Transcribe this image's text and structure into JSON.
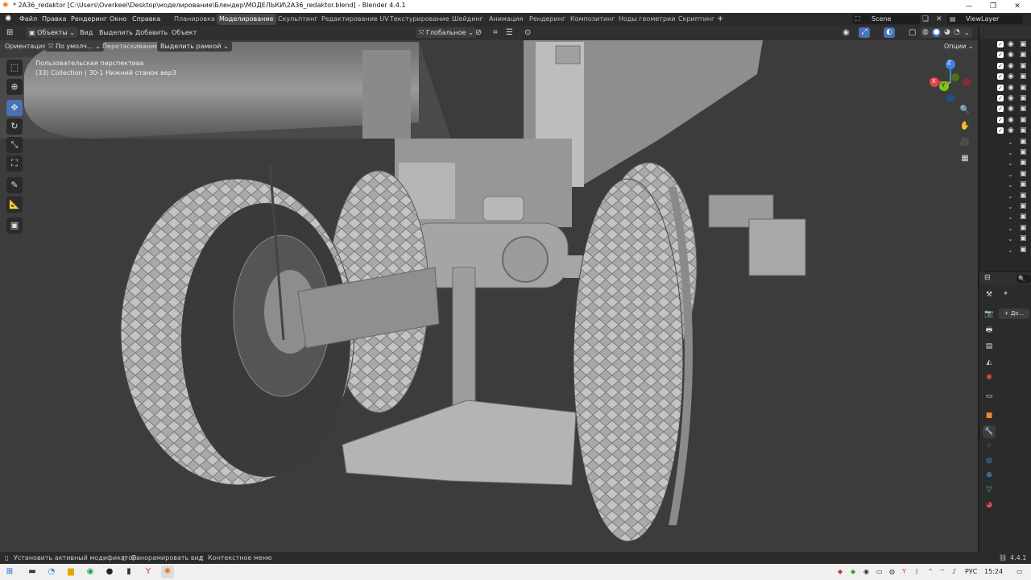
{
  "window": {
    "title": "* 2A36_redaktor [C:\\Users\\Overkeel\\Desktop\\моделирование\\Блендер\\МОДЕЛЬКИ\\2A36_redaktor.blend] - Blender 4.4.1",
    "minimize": "—",
    "maximize": "❐",
    "close": "✕"
  },
  "menu": [
    "Файл",
    "Правка",
    "Рендеринг",
    "Окно",
    "Справка"
  ],
  "workspaces": [
    {
      "label": "Планировка"
    },
    {
      "label": "Моделирование",
      "active": true
    },
    {
      "label": "Скульптинг"
    },
    {
      "label": "Редактирование UV"
    },
    {
      "label": "Текстурирование"
    },
    {
      "label": "Шейдинг"
    },
    {
      "label": "Анимация"
    },
    {
      "label": "Рендеринг"
    },
    {
      "label": "Композитинг"
    },
    {
      "label": "Ноды геометрии"
    },
    {
      "label": "Скриптинг"
    }
  ],
  "add_workspace": "+",
  "scene": {
    "name": "Scene",
    "view_layer": "ViewLayer"
  },
  "viewport_header": {
    "mode": "Объекты",
    "menus": [
      "Вид",
      "Выделить",
      "Добавить",
      "Объект"
    ],
    "transform_orientation": "Глобальное"
  },
  "tool_settings": {
    "orientation_label": "Ориентация:",
    "orientation_value": "По умолч...",
    "drag_label": "Перетаскивание:",
    "drag_value": "Выделить рамкой",
    "options": "Опции"
  },
  "overlay": {
    "view_name": "Пользовательская перспектива",
    "collection_info": "(33) Collection | 30-1 Нижний станок вер3"
  },
  "gizmo": {
    "x": "X",
    "y": "Y",
    "z": "Z"
  },
  "tools": [
    "select-box-icon",
    "cursor-icon",
    "move-icon",
    "rotate-icon",
    "scale-icon",
    "transform-icon",
    "annotate-icon",
    "measure-icon",
    "add-cube-icon"
  ],
  "outliner_rows": 20,
  "outliner_checked_rows": 9,
  "properties": {
    "add_modifier": "+ До..."
  },
  "status": {
    "left1": "Установить активный модификатор",
    "left2": "Панорамировать вид",
    "left3": "Контекстное меню",
    "version": "4.4.1"
  },
  "taskbar": {
    "lang": "РУС",
    "time": "15:24"
  },
  "colors": {
    "accent": "#4772b3",
    "viewport_bg": "#3c3c3c",
    "axis_x": "#e4414f",
    "axis_y": "#7cc41a",
    "axis_z": "#3f86e2"
  }
}
